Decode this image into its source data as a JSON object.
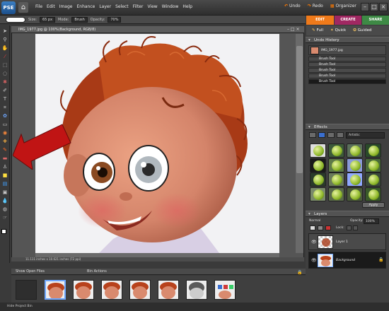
{
  "app": {
    "logo": "PSE",
    "menu": [
      "File",
      "Edit",
      "Image",
      "Enhance",
      "Layer",
      "Select",
      "Filter",
      "View",
      "Window",
      "Help"
    ],
    "undo_label": "Undo",
    "redo_label": "Redo",
    "organizer_label": "Organizer"
  },
  "options": {
    "size_label": "Size:",
    "size_value": "65 px",
    "mode_label": "Mode:",
    "mode_value": "Brush",
    "opacity_label": "Opacity:",
    "opacity_value": "70%"
  },
  "mode_tabs": {
    "edit": "EDIT",
    "create": "CREATE",
    "share": "SHARE"
  },
  "edit_tabs": [
    "Full",
    "Quick",
    "Guided"
  ],
  "document": {
    "title": "IMG_1977.jpg @ 100%(Background, RGB/8)",
    "status": "11.111 inches x 10.621 inches (72 ppi)"
  },
  "undo_history": {
    "title": "Undo History",
    "items": [
      "IMG_1977.jpg",
      "Brush Tool",
      "Brush Tool",
      "Brush Tool",
      "Brush Tool",
      "Brush Tool"
    ]
  },
  "effects": {
    "title": "Effects",
    "category": "Artistic",
    "apply_label": "Apply"
  },
  "layers": {
    "title": "Layers",
    "blend_mode": "Normal",
    "opacity_label": "Opacity:",
    "opacity_value": "100%",
    "lock_label": "Lock:",
    "items": [
      "Layer 1",
      "Background"
    ]
  },
  "bin": {
    "show_label": "Show Open Files",
    "actions_label": "Bin Actions",
    "hide_label": "Hide Project Bin"
  },
  "colors": {
    "edit_tab": "#f07a1a",
    "create_tab": "#a02862",
    "share_tab": "#3e8a45",
    "hair": "#b8421c",
    "face": "#d98a6e",
    "annotation_arrow": "#c01414"
  }
}
